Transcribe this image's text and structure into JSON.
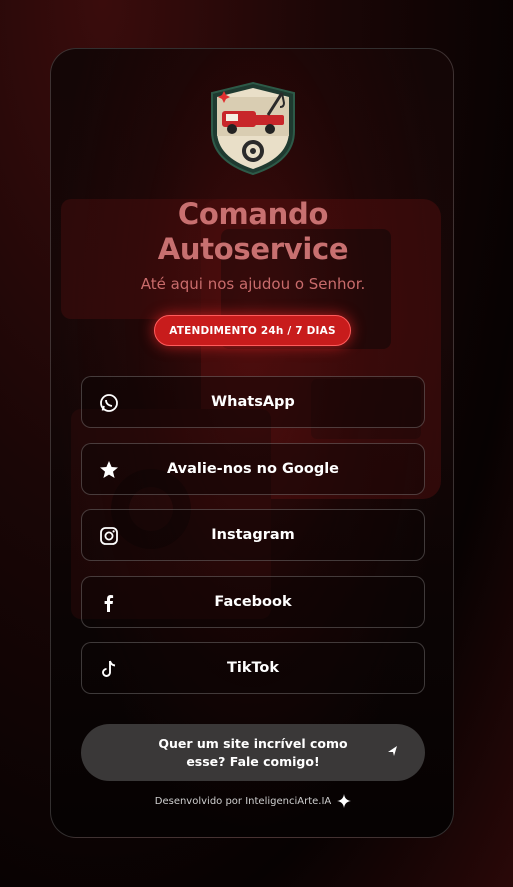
{
  "profile": {
    "name": "Comando Autoservice",
    "name_line1": "Comando",
    "name_line2": "Autoservice",
    "tagline": "Até aqui nos ajudou o Senhor.",
    "badge": "ATENDIMENTO 24h / 7 DIAS"
  },
  "links": [
    {
      "label": "WhatsApp",
      "icon": "whatsapp-icon"
    },
    {
      "label": "Avalie-nos no Google",
      "icon": "star-icon"
    },
    {
      "label": "Instagram",
      "icon": "instagram-icon"
    },
    {
      "label": "Facebook",
      "icon": "facebook-icon"
    },
    {
      "label": "TikTok",
      "icon": "tiktok-icon"
    }
  ],
  "cta": {
    "label": "Quer um site incrível como esse? Fale comigo!",
    "icon": "cursor-arrow-icon"
  },
  "footer": {
    "text": "Desenvolvido por InteligenciArte.IA",
    "icon": "sparkle-icon"
  },
  "colors": {
    "accent": "#c81c1c",
    "title": "#c87070",
    "background": "#0b0404"
  }
}
